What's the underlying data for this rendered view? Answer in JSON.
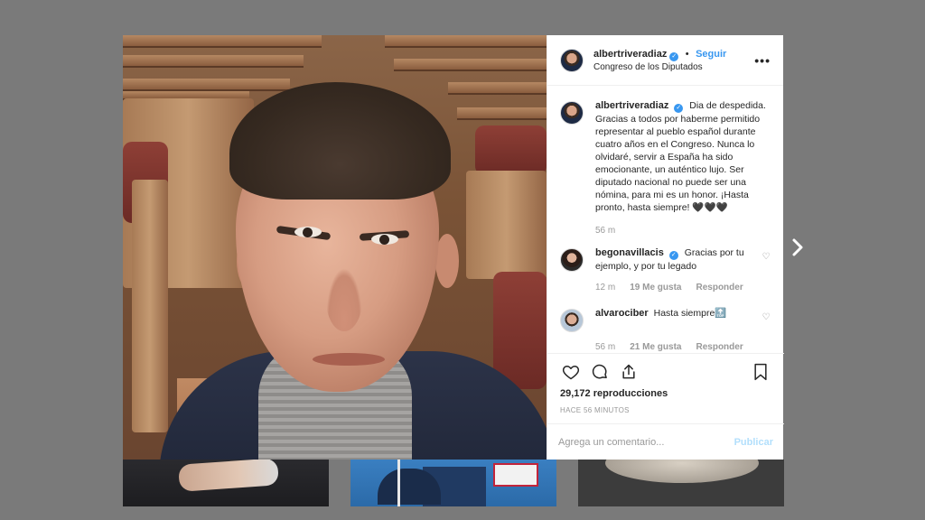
{
  "post": {
    "author": "albertriveradiaz",
    "separator": "•",
    "follow_label": "Seguir",
    "location": "Congreso de los Diputados",
    "more_label": "•••",
    "caption": "Dia de despedida. Gracias a todos por haberme permitido representar al pueblo español durante cuatro años en el Congreso. Nunca lo olvidaré, servir a España ha sido emocionante, un auténtico lujo. Ser diputado nacional no puede ser una nómina, para mi es un honor. ¡Hasta pronto, hasta siempre! 🖤🖤🖤",
    "caption_time": "56 m"
  },
  "comments": [
    {
      "user": "begonavillacis",
      "text": "Gracias por tu ejemplo, y por tu legado",
      "time": "12 m",
      "likes": "19 Me gusta",
      "reply": "Responder"
    },
    {
      "user": "alvarociber",
      "text": "Hasta siempre🔝",
      "time": "56 m",
      "likes": "21 Me gusta",
      "reply": "Responder"
    }
  ],
  "stats": {
    "views": "29,172 reproducciones",
    "ago": "HACE 56 MINUTOS"
  },
  "composer": {
    "placeholder": "Agrega un comentario...",
    "publish_label": "Publicar"
  },
  "colors": {
    "accent": "#3897f0",
    "overlay": "#7a7a7a",
    "publish_disabled": "#b2dffc"
  },
  "icons": [
    "heart-icon",
    "comment-icon",
    "share-icon",
    "bookmark-icon",
    "verified-icon",
    "chevron-right-icon",
    "more-icon"
  ]
}
